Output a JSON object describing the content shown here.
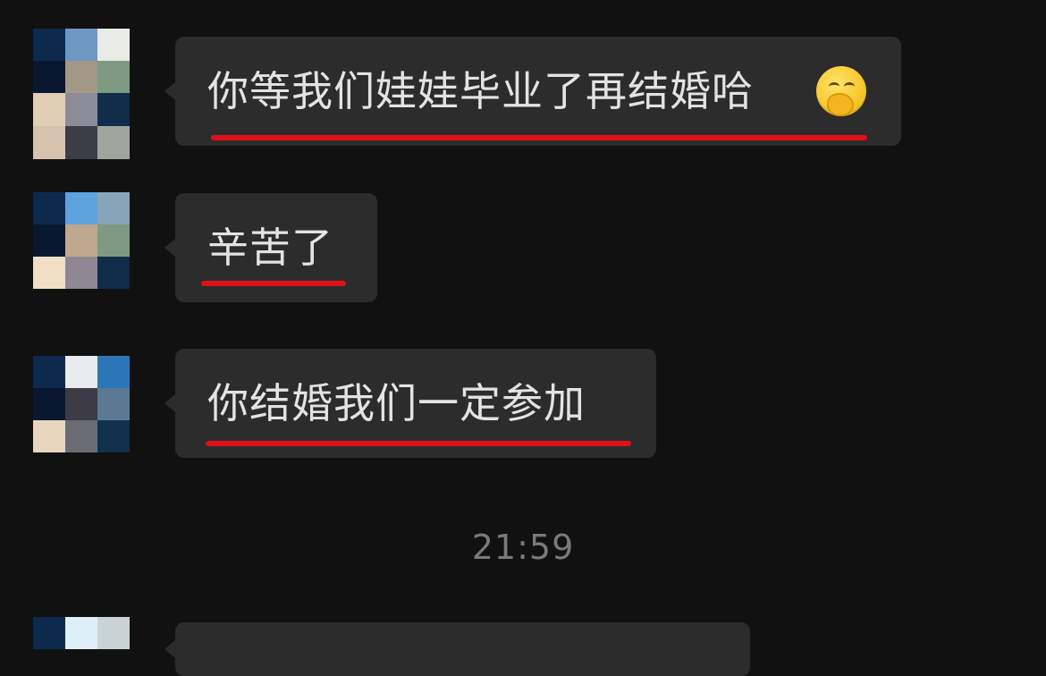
{
  "messages": [
    {
      "text": "你等我们娃娃毕业了再结婚哈",
      "emoji": "hand-over-mouth-emoji"
    },
    {
      "text": "辛苦了"
    },
    {
      "text": "你结婚我们一定参加"
    },
    {
      "text": ""
    }
  ],
  "timestamp": "21:59",
  "colors": {
    "background": "#111111",
    "bubble": "#2c2c2c",
    "text": "#e3e3e3",
    "underline": "#e0101a",
    "timestamp": "#7a7a7a"
  },
  "avatars": [
    [
      "#0d2a4e",
      "#6f97c4",
      "#e9ece6",
      "#0a1730",
      "#a19886",
      "#7f9a82",
      "#e2cdb5",
      "#8c8c98",
      "#102d4b",
      "#d6c2ad",
      "#3a3f47",
      "#9fa69b"
    ],
    [
      "#0d2a4e",
      "#5ea2de",
      "#88a4b8",
      "#0a1730",
      "#bfa88e",
      "#7f9a82",
      "#f1dec5",
      "#8f8794",
      "#0f2c48"
    ],
    [
      "#0d2a4e",
      "#e9ebef",
      "#2c76b8",
      "#0a1730",
      "#3b3a45",
      "#5b7993",
      "#ead6bf",
      "#6b6b73",
      "#10304d"
    ],
    [
      "#0d2a4e",
      "#dfeff8",
      "#c9d3d6"
    ]
  ]
}
